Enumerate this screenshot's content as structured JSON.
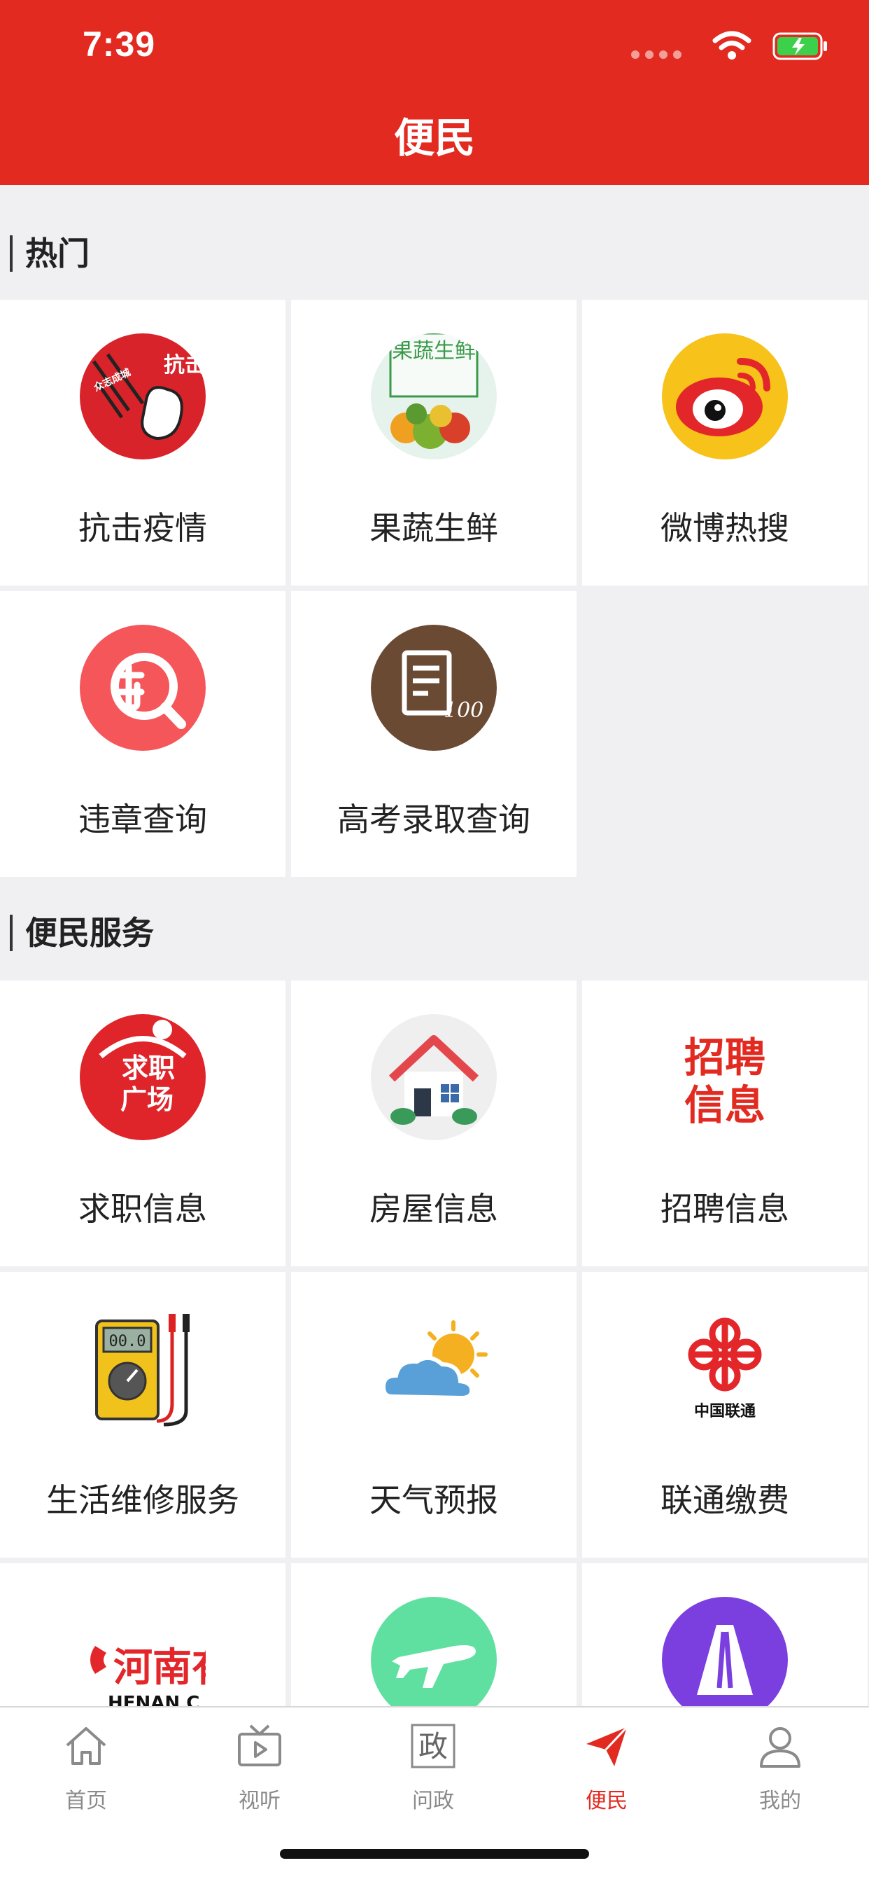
{
  "status": {
    "time": "7:39"
  },
  "header": {
    "title": "便民"
  },
  "sections": {
    "hot": {
      "title": "热门"
    },
    "services": {
      "title": "便民服务"
    }
  },
  "hot_items": [
    {
      "label": "抗击疫情",
      "icon": "anti-epidemic-icon",
      "badge_text": "抗击",
      "badge_sub": "众志成城"
    },
    {
      "label": "果蔬生鲜",
      "icon": "fresh-produce-icon",
      "badge_text": "果蔬生鲜"
    },
    {
      "label": "微博热搜",
      "icon": "weibo-icon"
    },
    {
      "label": "违章查询",
      "icon": "traffic-violation-icon"
    },
    {
      "label": "高考录取查询",
      "icon": "exam-admission-icon"
    }
  ],
  "service_items": [
    {
      "label": "求职信息",
      "icon": "job-square-icon",
      "badge_text": "求职广场"
    },
    {
      "label": "房屋信息",
      "icon": "house-icon"
    },
    {
      "label": "招聘信息",
      "icon": "recruitment-icon",
      "badge_text": "招聘信息"
    },
    {
      "label": "生活维修服务",
      "icon": "multimeter-icon"
    },
    {
      "label": "天气预报",
      "icon": "weather-icon"
    },
    {
      "label": "联通缴费",
      "icon": "china-unicom-icon",
      "badge_text": "中国联通"
    },
    {
      "label": "",
      "icon": "henan-airline-icon",
      "badge_text": "河南有",
      "badge_sub": "HENAN C"
    },
    {
      "label": "",
      "icon": "flight-icon"
    },
    {
      "label": "",
      "icon": "highway-icon"
    }
  ],
  "tabs": [
    {
      "label": "首页",
      "icon": "home-icon",
      "active": false
    },
    {
      "label": "视听",
      "icon": "tv-icon",
      "active": false
    },
    {
      "label": "问政",
      "icon": "zheng-icon",
      "glyph": "政",
      "active": false
    },
    {
      "label": "便民",
      "icon": "send-icon",
      "active": true
    },
    {
      "label": "我的",
      "icon": "profile-icon",
      "active": false
    }
  ],
  "colors": {
    "brand_red": "#e22a20",
    "tab_inactive": "#8a8a8a"
  }
}
